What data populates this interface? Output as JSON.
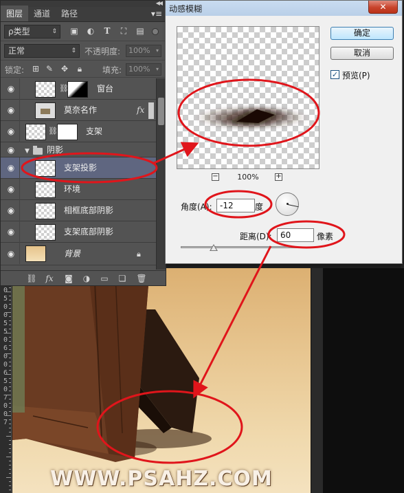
{
  "layers_panel": {
    "tabs": [
      "图层",
      "通道",
      "路径"
    ],
    "active_tab": 0,
    "filter_label": "ρ类型",
    "filter_icons": [
      "image-filter-icon",
      "adjustment-filter-icon",
      "type-filter-icon",
      "shape-filter-icon",
      "smart-object-filter-icon"
    ],
    "blend_mode": "正常",
    "opacity_label": "不透明度:",
    "opacity_value": "100%",
    "lock_label": "锁定:",
    "fill_label": "填充:",
    "fill_value": "100%",
    "layers": [
      {
        "name": "窗台",
        "has_mask": true,
        "mask_style": "gradient",
        "selected": false
      },
      {
        "name": "莫奈名作",
        "fx": "fx",
        "selected": false
      },
      {
        "name": "支架",
        "has_mask": true,
        "mask_style": "white",
        "selected": false
      },
      {
        "name": "阴影",
        "is_group": true,
        "selected": false
      },
      {
        "name": "支架投影",
        "selected": true
      },
      {
        "name": "环境",
        "selected": false
      },
      {
        "name": "相框底部阴影",
        "selected": false
      },
      {
        "name": "支架底部阴影",
        "selected": false
      },
      {
        "name": "背景",
        "locked": true,
        "selected": false
      }
    ],
    "footer_icons": [
      "link-layers-icon",
      "fx-icon",
      "add-mask-icon",
      "adjustment-layer-icon",
      "new-group-icon",
      "new-layer-icon",
      "trash-icon"
    ],
    "footer_fx": "fx"
  },
  "dialog": {
    "title": "动感模糊",
    "ok_label": "确定",
    "cancel_label": "取消",
    "preview_label": "预览(P)",
    "preview_checked": true,
    "zoom_minus": "−",
    "zoom_plus": "+",
    "zoom_value": "100%",
    "angle_label": "角度(A):",
    "angle_value": "-12",
    "angle_unit": "度",
    "distance_label": "距离(D):",
    "distance_value": "60",
    "distance_unit": "像素",
    "close_glyph": "✕"
  },
  "canvas": {
    "ruler_labels": [
      "0",
      "5",
      "0",
      "0",
      "5",
      "5",
      "0",
      "6",
      "0",
      "0",
      "6",
      "5",
      "0",
      "7",
      "0",
      "0",
      "7"
    ],
    "watermark": "WWW.PSAHZ.COM"
  },
  "colors": {
    "annotation_red": "#e0151b",
    "panel_bg": "#535353",
    "selected_layer": "#5f6680"
  }
}
